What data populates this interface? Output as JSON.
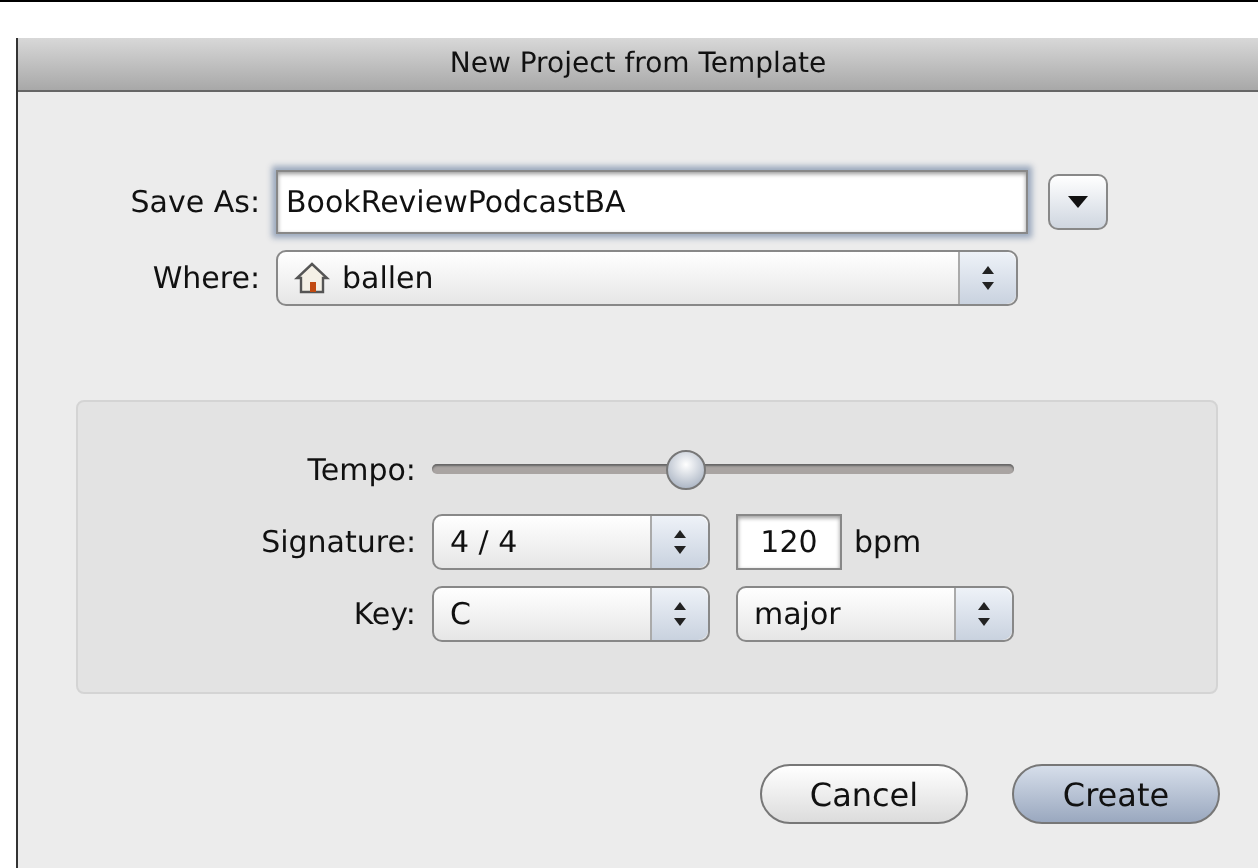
{
  "window": {
    "title": "New Project from Template"
  },
  "save_as": {
    "label": "Save As:",
    "value": "BookReviewPodcastBA"
  },
  "where": {
    "label": "Where:",
    "value": "ballen"
  },
  "tempo": {
    "label": "Tempo:",
    "level": 0.43
  },
  "signature": {
    "label": "Signature:",
    "value": "4 / 4",
    "bpm": "120",
    "unit": "bpm"
  },
  "key": {
    "label": "Key:",
    "value": "C",
    "mode": "major"
  },
  "buttons": [
    {
      "label": "Cancel",
      "kind": "normal"
    },
    {
      "label": "Create",
      "kind": "default"
    }
  ]
}
